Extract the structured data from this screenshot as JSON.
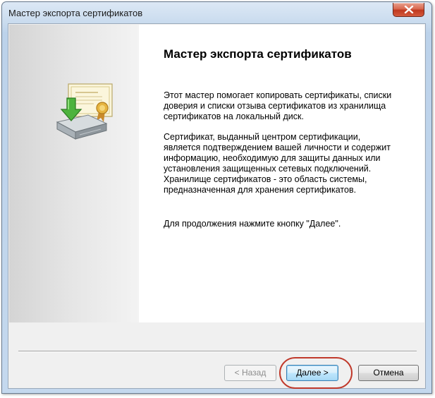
{
  "window": {
    "title": "Мастер экспорта сертификатов"
  },
  "titlebar": {
    "close_icon": "close-icon"
  },
  "side_panel": {
    "icon": "certificate-export-icon"
  },
  "content": {
    "heading": "Мастер экспорта сертификатов",
    "paragraph1": "Этот мастер помогает копировать сертификаты, списки доверия и списки отзыва сертификатов из хранилища сертификатов на локальный диск.",
    "paragraph2": "Сертификат, выданный центром сертификации, является подтверждением вашей личности и содержит информацию, необходимую для защиты данных или установления защищенных сетевых подключений. Хранилище сертификатов - это область системы, предназначенная для хранения сертификатов.",
    "paragraph3": "Для продолжения нажмите кнопку \"Далее\"."
  },
  "buttons": {
    "back_label": "< Назад",
    "next_label": "Далее >",
    "cancel_label": "Отмена"
  },
  "colors": {
    "annotation_ring": "#c0392b",
    "titlebar": "#c4d8ee",
    "close_button": "#c0391f"
  }
}
